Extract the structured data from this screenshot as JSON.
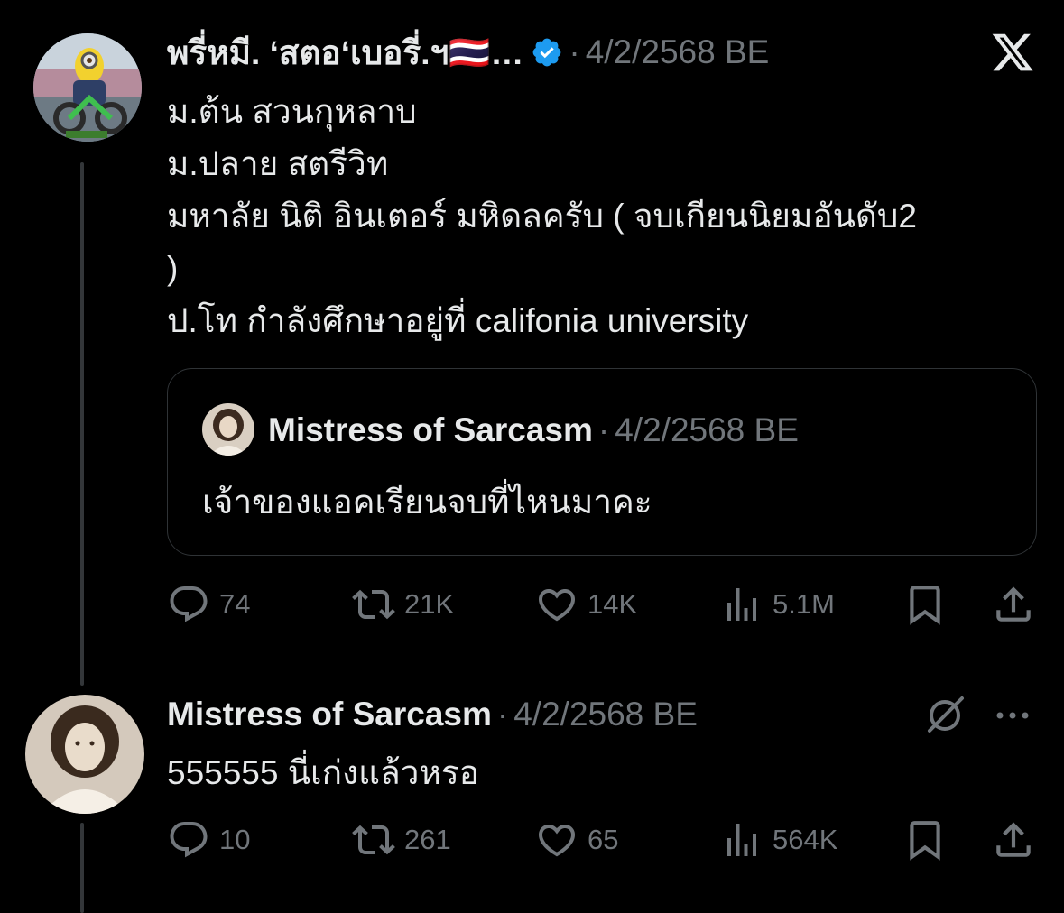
{
  "tweet1": {
    "author": "พรี่หมี. ‘สตอ‘เบอรี่.ฯ🇹🇭…",
    "separator": "·",
    "timestamp": "4/2/2568 BE",
    "lines": [
      "ม.ต้น สวนกุหลาบ",
      "ม.ปลาย สตรีวิท",
      "มหาลัย นิติ อินเตอร์ มหิดลครับ ( จบเกียนนิยมอันดับ2",
      ")",
      "ป.โท กำลังศึกษาอยู่ที่ califonia university"
    ],
    "quote": {
      "author": "Mistress of Sarcasm",
      "separator": "·",
      "timestamp": "4/2/2568 BE",
      "text": "เจ้าของแอคเรียนจบที่ไหนมาคะ"
    },
    "stats": {
      "replies": "74",
      "reposts": "21K",
      "likes": "14K",
      "views": "5.1M"
    }
  },
  "tweet2": {
    "author": "Mistress of Sarcasm",
    "separator": "·",
    "timestamp": "4/2/2568 BE",
    "text": "555555 นี่เก่งแล้วหรอ",
    "stats": {
      "replies": "10",
      "reposts": "261",
      "likes": "65",
      "views": "564K"
    }
  },
  "icons": {
    "verified": "verified-badge-icon",
    "x_logo": "x-logo-icon",
    "grok": "grok-icon",
    "more": "more-icon"
  },
  "colors": {
    "background": "#000000",
    "text": "#e7e9ea",
    "muted": "#71767b",
    "verified_blue": "#1d9bf0",
    "border": "#2f3336"
  }
}
